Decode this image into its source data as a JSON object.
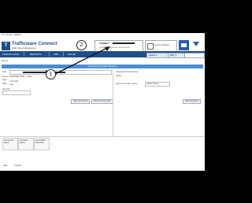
{
  "window": {
    "title": "TC Connect - Default"
  },
  "header": {
    "brand": "Trafficware Connect",
    "brand_sub": "Traffic Signal Management",
    "user": {
      "name": "CONNECT",
      "sub": "Logged in · Connect user account"
    },
    "connect_label": "Connect Settings"
  },
  "nav": {
    "items": [
      "TRAFFIC DATA",
      "REPORTS",
      "TMC",
      "SETUP"
    ]
  },
  "toolbar": {
    "search1": "Search ▾",
    "search2": "EXIT ▾"
  },
  "breadcrumb": "Home",
  "panel": {
    "title": "Intersection Program Request"
  },
  "form": {
    "left": {
      "search_label": "Find",
      "name_label": "Name",
      "name_value": "INTERSECTION · 4 Way",
      "type_label": "Type",
      "type_value": "Controller",
      "addr_label": "Addr",
      "addr_value": "Lane",
      "note_label": "Ctrl Info",
      "buttons": [
        "Save Intersection",
        "Remove Intersection"
      ]
    },
    "right": {
      "label1": "Intersection List Preview",
      "label2": "Select",
      "label3": "Filter by corridor / group",
      "select_value": "Select Group",
      "button": "Add Intersection"
    }
  },
  "table": {
    "headers": [
      "Intersection Name",
      "Controller Status",
      "Last Update Received"
    ]
  },
  "footer": {
    "items": [
      "Help",
      "Contact"
    ]
  },
  "callouts": [
    "1",
    "2"
  ],
  "colors": {
    "brand": "#1d4f8a",
    "panel": "#4a8ed1",
    "accent": "#2a5da8"
  }
}
